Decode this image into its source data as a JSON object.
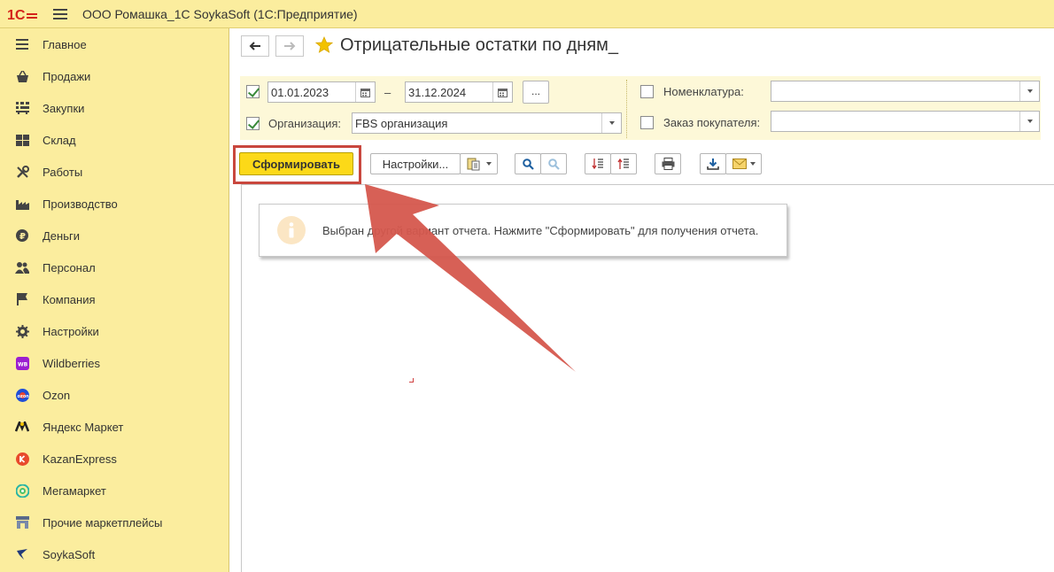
{
  "app": {
    "title": "ООО Ромашка_1С SoykaSoft  (1С:Предприятие)",
    "logo_icon": "1c-logo-icon",
    "menu_icon": "hamburger-menu-icon"
  },
  "sidebar": {
    "items": [
      {
        "label": "Главное",
        "icon": "list-icon"
      },
      {
        "label": "Продажи",
        "icon": "basket-icon"
      },
      {
        "label": "Закупки",
        "icon": "cart-icon"
      },
      {
        "label": "Склад",
        "icon": "warehouse-grid-icon"
      },
      {
        "label": "Работы",
        "icon": "tools-icon"
      },
      {
        "label": "Производство",
        "icon": "factory-icon"
      },
      {
        "label": "Деньги",
        "icon": "ruble-coin-icon"
      },
      {
        "label": "Персонал",
        "icon": "people-icon"
      },
      {
        "label": "Компания",
        "icon": "flag-icon"
      },
      {
        "label": "Настройки",
        "icon": "gear-icon"
      },
      {
        "label": "Wildberries",
        "icon": "wildberries-icon"
      },
      {
        "label": "Ozon",
        "icon": "ozon-icon"
      },
      {
        "label": "Яндекс Маркет",
        "icon": "yandex-market-icon"
      },
      {
        "label": "KazanExpress",
        "icon": "kazanexpress-icon"
      },
      {
        "label": "Мегамаркет",
        "icon": "megamarket-icon"
      },
      {
        "label": "Прочие маркетплейсы",
        "icon": "marketplaces-icon"
      },
      {
        "label": "SoykaSoft",
        "icon": "soykasoft-icon"
      }
    ]
  },
  "page": {
    "title": "Отрицательные остатки по дням_",
    "favorite_icon": "star-icon"
  },
  "filters": {
    "period_checked": true,
    "date_from": "01.01.2023",
    "date_to": "31.12.2024",
    "dash": "–",
    "dots_label": "...",
    "org_checked": true,
    "org_label": "Организация:",
    "org_value": "FBS организация",
    "nomenclature_checked": false,
    "nomenclature_label": "Номенклатура:",
    "nomenclature_value": "",
    "order_checked": false,
    "order_label": "Заказ покупателя:",
    "order_value": ""
  },
  "toolbar": {
    "generate_label": "Сформировать",
    "settings_label": "Настройки..."
  },
  "message": {
    "text": "Выбран другой вариант отчета. Нажмите \"Сформировать\" для получения отчета."
  },
  "colors": {
    "accent_yellow": "#fcd918",
    "panel_yellow": "#fbed9e",
    "annotation_red": "#c9473e"
  }
}
